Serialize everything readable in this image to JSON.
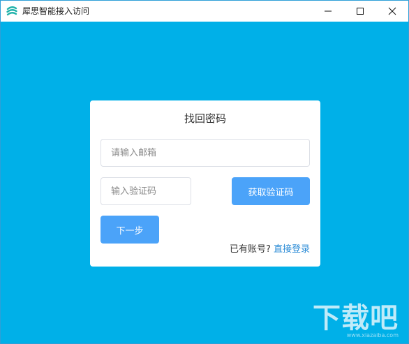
{
  "window": {
    "title": "犀思智能接入访问",
    "controls": {
      "minimize": "minimize",
      "maximize": "maximize",
      "close": "close"
    }
  },
  "card": {
    "title": "找回密码",
    "email_placeholder": "请输入邮箱",
    "email_value": "",
    "code_placeholder": "输入验证码",
    "code_value": "",
    "get_code_label": "获取验证码",
    "next_label": "下一步",
    "have_account_text": "已有账号?",
    "login_link": "直接登录"
  },
  "watermark": {
    "text": "下载吧",
    "url": "www.xiazaiba.com"
  },
  "colors": {
    "background": "#00b0e8",
    "button": "#4ba3f9",
    "link": "#2a8bd6",
    "icon": "#20b2aa"
  },
  "icons": {
    "app": "app-logo-icon",
    "minimize": "minimize-icon",
    "maximize": "maximize-icon",
    "close": "close-icon"
  }
}
